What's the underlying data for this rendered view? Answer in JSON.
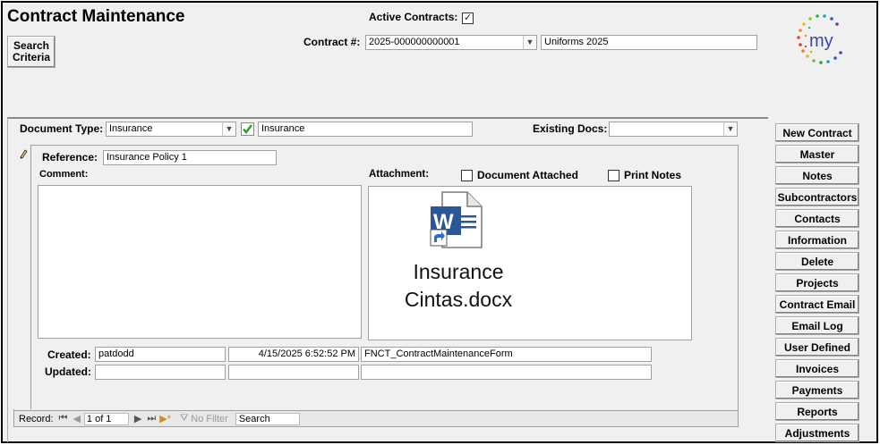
{
  "header": {
    "title": "Contract Maintenance",
    "search_criteria_label": "Search Criteria",
    "active_contracts_label": "Active Contracts:",
    "active_contracts_checked": true,
    "contract_label": "Contract #:",
    "contract_number": "2025-000000000001",
    "contract_name": "Uniforms 2025",
    "logo_text": "my"
  },
  "document": {
    "type_label": "Document Type:",
    "type_value": "Insurance",
    "type_description": "Insurance",
    "existing_docs_label": "Existing Docs:",
    "existing_docs_value": "",
    "reference_label": "Reference:",
    "reference_value": "Insurance Policy 1",
    "comment_label": "Comment:",
    "comment_value": "",
    "attachment_label": "Attachment:",
    "document_attached_label": "Document Attached",
    "document_attached_checked": false,
    "print_notes_label": "Print Notes",
    "print_notes_checked": false,
    "attachment_file_line1": "Insurance",
    "attachment_file_line2": "Cintas.docx",
    "attachment_icon": "word-document-shortcut-icon",
    "created_label": "Created:",
    "created_by": "patdodd",
    "created_date": "4/15/2025 6:52:52 PM",
    "created_form": "FNCT_ContractMaintenanceForm",
    "updated_label": "Updated:",
    "updated_by": "",
    "updated_date": "",
    "updated_form": ""
  },
  "record_nav": {
    "record_label": "Record:",
    "position": "1 of 1",
    "filter_label": "No Filter",
    "search_label": "Search"
  },
  "side_buttons": [
    "New Contract",
    "Master",
    "Notes",
    "Subcontractors",
    "Contacts",
    "Information",
    "Delete",
    "Projects",
    "Contract Email",
    "Email Log",
    "User Defined",
    "Invoices",
    "Payments",
    "Reports",
    "Adjustments"
  ],
  "colors": {
    "window_bg": "#f0f0f0",
    "valid_check": "#2e9a2e",
    "word_blue": "#2b5797"
  }
}
